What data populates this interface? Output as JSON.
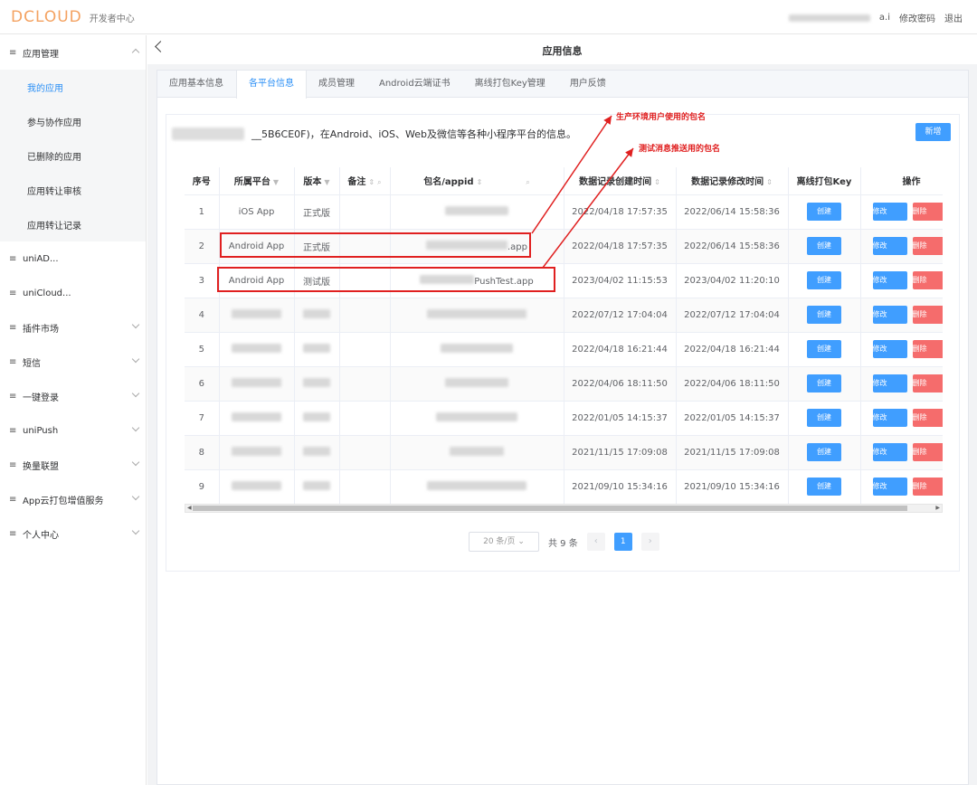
{
  "header": {
    "logo_text": "DCLOUD",
    "logo_sub": "开发者中心",
    "user_suffix": "a.i",
    "change_password": "修改密码",
    "logout": "退出"
  },
  "sidebar": {
    "groups": [
      {
        "label": "应用管理",
        "expanded": true
      },
      {
        "label": "uniAD..."
      },
      {
        "label": "uniCloud..."
      },
      {
        "label": "插件市场"
      },
      {
        "label": "短信"
      },
      {
        "label": "一键登录"
      },
      {
        "label": "uniPush"
      },
      {
        "label": "换量联盟"
      },
      {
        "label": "App云打包增值服务"
      },
      {
        "label": "个人中心"
      }
    ],
    "sub_items": [
      "我的应用",
      "参与协作应用",
      "已删除的应用",
      "应用转让审核",
      "应用转让记录"
    ]
  },
  "page": {
    "title": "应用信息",
    "tabs": [
      "应用基本信息",
      "各平台信息",
      "成员管理",
      "Android云端证书",
      "离线打包Key管理",
      "用户反馈"
    ],
    "notice": "__5B6CE0F)，在Android、iOS、Web及微信等各种小程序平台的信息。",
    "new_button": "新增"
  },
  "table": {
    "headers": [
      "序号",
      "所属平台",
      "版本",
      "备注",
      "包名/appid",
      "数据记录创建时间",
      "数据记录修改时间",
      "离线打包Key",
      "操作"
    ],
    "create_label": "创建",
    "edit_label": "修改",
    "delete_label": "删除",
    "rows": [
      {
        "no": "1",
        "platform": "iOS App",
        "version": "正式版",
        "pkg": "",
        "created": "2022/04/18 17:57:35",
        "modified": "2022/06/14 15:58:36"
      },
      {
        "no": "2",
        "platform": "Android App",
        "version": "正式版",
        "pkg": ".app",
        "created": "2022/04/18 17:57:35",
        "modified": "2022/06/14 15:58:36"
      },
      {
        "no": "3",
        "platform": "Android App",
        "version": "测试版",
        "pkg": "PushTest.app",
        "created": "2023/04/02 11:15:53",
        "modified": "2023/04/02 11:20:10"
      },
      {
        "no": "4",
        "platform": "",
        "version": "",
        "pkg": "",
        "created": "2022/07/12 17:04:04",
        "modified": "2022/07/12 17:04:04"
      },
      {
        "no": "5",
        "platform": "",
        "version": "",
        "pkg": "",
        "created": "2022/04/18 16:21:44",
        "modified": "2022/04/18 16:21:44"
      },
      {
        "no": "6",
        "platform": "",
        "version": "",
        "pkg": "",
        "created": "2022/04/06 18:11:50",
        "modified": "2022/04/06 18:11:50"
      },
      {
        "no": "7",
        "platform": "",
        "version": "",
        "pkg": "",
        "created": "2022/01/05 14:15:37",
        "modified": "2022/01/05 14:15:37"
      },
      {
        "no": "8",
        "platform": "",
        "version": "",
        "pkg": "",
        "created": "2021/11/15 17:09:08",
        "modified": "2021/11/15 17:09:08"
      },
      {
        "no": "9",
        "platform": "",
        "version": "",
        "pkg": "",
        "created": "2021/09/10 15:34:16",
        "modified": "2021/09/10 15:34:16"
      }
    ]
  },
  "pagination": {
    "page_size": "20 条/页",
    "total": "共 9 条",
    "current": "1"
  },
  "annotations": {
    "prod": "生产环境用户使用的包名",
    "test": "测试消息推送用的包名"
  }
}
